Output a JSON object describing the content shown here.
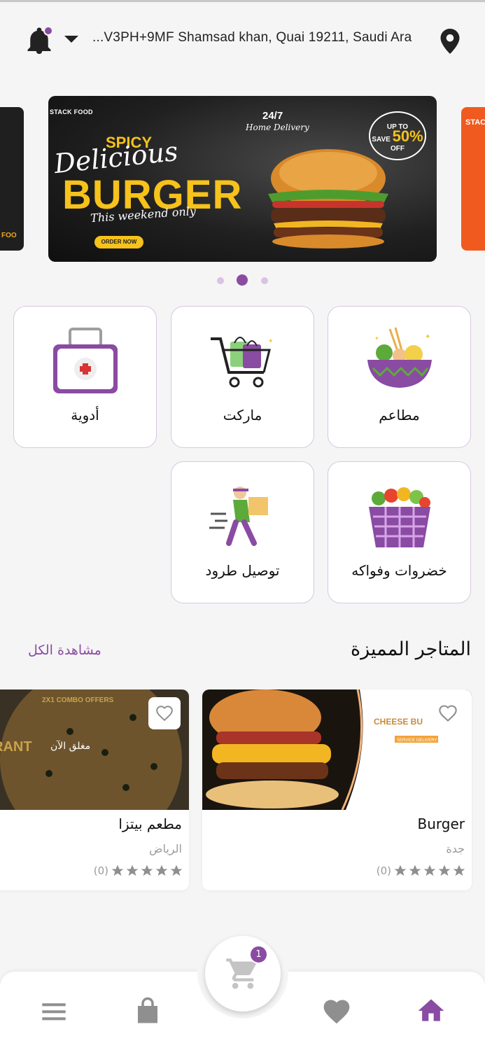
{
  "header": {
    "address": "...V3PH+9MF Shamsad khan, Quai 19211, Saudi Ara",
    "icons": [
      "bell-icon",
      "chevron-down-icon",
      "location-pin-icon"
    ]
  },
  "banner": {
    "brand": "STACK FOOD",
    "spicy": "SPICY",
    "delicious": "Delicious",
    "burger": "BURGER",
    "weekend": "This weekend only",
    "order_now": "ORDER NOW",
    "delivery_247": "24/7",
    "home_delivery": "Home Delivery",
    "sale_up_to": "UP TO",
    "sale_save": "SAVE",
    "sale_percent": "50%",
    "sale_off": "OFF",
    "side_left_text": "K FOO",
    "side_right_text": "STACK",
    "active_index": 1,
    "count": 3
  },
  "categories": [
    {
      "label": "مطاعم",
      "icon": "food-bowl-icon"
    },
    {
      "label": "ماركت",
      "icon": "shopping-cart-icon"
    },
    {
      "label": "أدوية",
      "icon": "medical-kit-icon"
    },
    {
      "label": "خضروات وفواكه",
      "icon": "vegetable-basket-icon"
    },
    {
      "label": "توصيل طرود",
      "icon": "delivery-courier-icon"
    }
  ],
  "featured": {
    "title": "المتاجر المميزة",
    "see_all": "مشاهدة الكل"
  },
  "stores": [
    {
      "name": "Burger",
      "city": "جدة",
      "rating_count": "(0)",
      "image_text": "CHEESE BU",
      "image_sub": "SERVICE DELIVERY",
      "status": ""
    },
    {
      "name": "مطعم بيتزا",
      "city": "الرياض",
      "rating_count": "(0)",
      "image_text": "RANT",
      "image_sub": "2X1 COMBO OFFERS",
      "status": "مغلق الآن"
    }
  ],
  "bottom_nav": {
    "items": [
      "menu-icon",
      "shopping-bag-icon",
      "cart-icon",
      "heart-icon",
      "home-icon"
    ],
    "cart_badge": "1",
    "active": "home-icon"
  },
  "colors": {
    "accent": "#8a4ba3",
    "background": "#f5f5f5",
    "star_gray": "#8f8f8f"
  }
}
